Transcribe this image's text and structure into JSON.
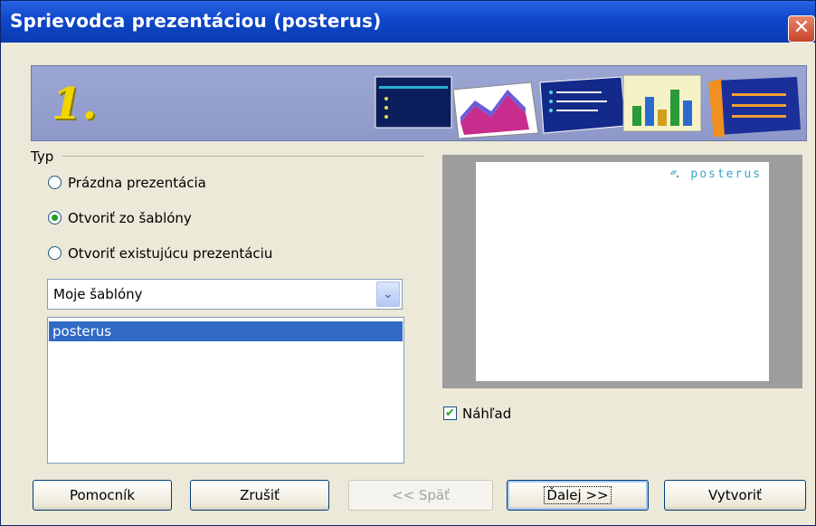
{
  "window": {
    "title": "Sprievodca prezentáciou (posterus)",
    "close_glyph": "✕"
  },
  "banner": {
    "step": "1."
  },
  "type_group": {
    "label": "Typ",
    "options": [
      {
        "label": "Prázdna prezentácia",
        "selected": false
      },
      {
        "label": "Otvoriť zo šablóny",
        "selected": true
      },
      {
        "label": "Otvoriť existujúcu prezentáciu",
        "selected": false
      }
    ]
  },
  "template_category": {
    "value": "Moje šablóny",
    "arrow": "⌄"
  },
  "template_list": {
    "items": [
      {
        "label": "posterus",
        "selected": true
      }
    ]
  },
  "preview": {
    "logo_text": "posterus",
    "checkbox_label": "Náhľad",
    "checked": true
  },
  "buttons": {
    "help": "Pomocník",
    "cancel": "Zrušiť",
    "back": "<< Späť",
    "next": "Ďalej >>",
    "create": "Vytvoriť"
  }
}
